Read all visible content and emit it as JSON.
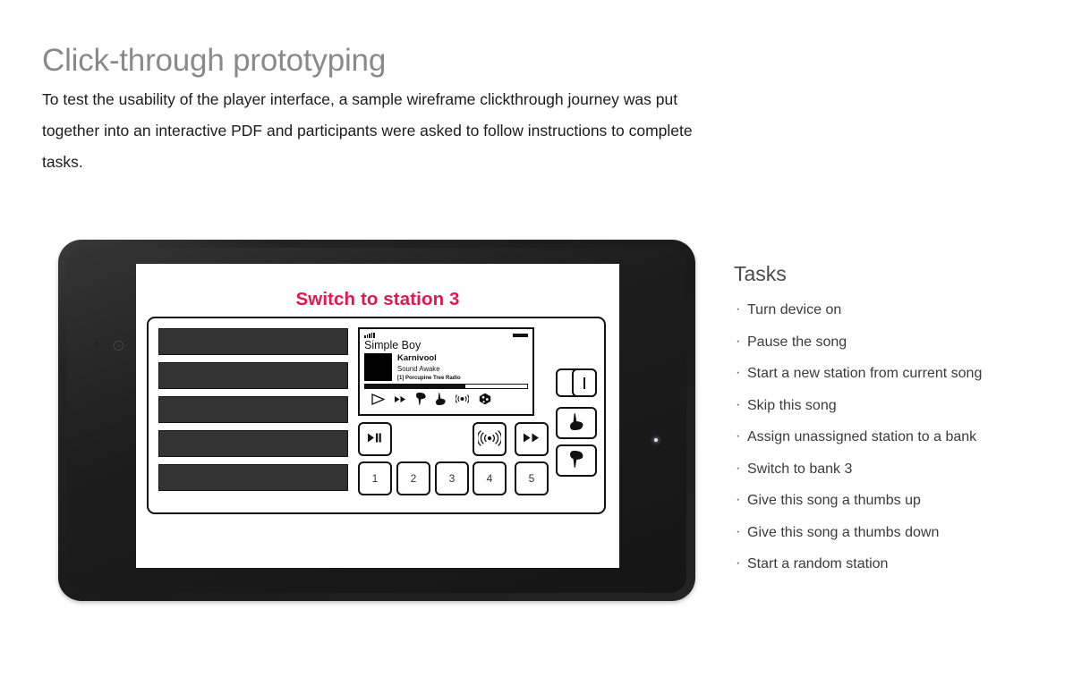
{
  "header": {
    "title": "Click-through prototyping",
    "paragraph": "To test the usability of the player interface, a sample wireframe clickthrough journey was put together into an interactive PDF and participants were asked to  follow instructions to complete tasks."
  },
  "colors": {
    "accent_pink": "#e5164f",
    "title_gray": "#8a8a8a",
    "body_text": "#1c1c1c",
    "tasks_text": "#3b3b3b",
    "station_bar": "#333333",
    "device_body": "#1a1a1a"
  },
  "prototype": {
    "instruction": "Switch to station 3",
    "station_list": [
      {
        "label": ""
      },
      {
        "label": ""
      },
      {
        "label": ""
      },
      {
        "label": ""
      },
      {
        "label": ""
      }
    ],
    "display": {
      "signal_icon": "signal-bars-icon",
      "battery_icon": "battery-icon",
      "station_name": "Simple Boy",
      "artist": "Karnivool",
      "album": "Sound Awake",
      "source": "[1] Porcupine Tree Radio",
      "progress_percent": 62,
      "controls": [
        {
          "name": "play-icon",
          "label": "Play"
        },
        {
          "name": "skip-icon",
          "label": "Skip"
        },
        {
          "name": "thumbs-down-icon",
          "label": "Thumbs down"
        },
        {
          "name": "thumbs-up-icon",
          "label": "Thumbs up"
        },
        {
          "name": "new-station-icon",
          "label": "New station"
        },
        {
          "name": "random-station-icon",
          "label": "Random station"
        }
      ]
    },
    "buttons": {
      "play_pause": "▶❙❙",
      "new_station": "((•))",
      "skip": "▶▶",
      "power_label": "",
      "thumb_up_label": "",
      "thumb_down_label": ""
    },
    "bank_buttons": [
      "1",
      "2",
      "3",
      "4",
      "5"
    ]
  },
  "tasks": {
    "title": "Tasks",
    "items": [
      "Turn device on",
      "Pause the song",
      "Start a new station from current song",
      "Skip this song",
      "Assign unassigned station to a bank",
      "Switch to bank 3",
      "Give this song a thumbs up",
      "Give this song a thumbs down",
      "Start a random station"
    ]
  }
}
